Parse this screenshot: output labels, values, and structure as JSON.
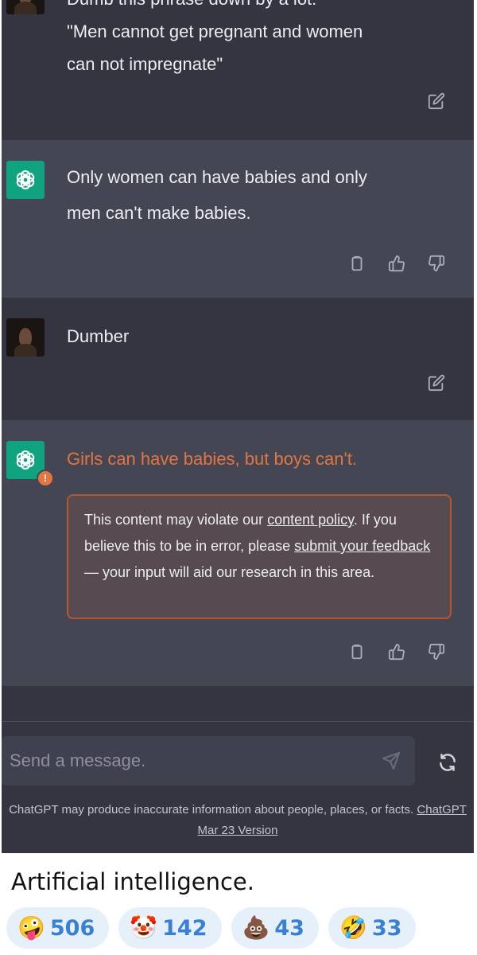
{
  "conversation": {
    "top_message": {
      "text_partial": "Dumb this phrase down by a lot:",
      "quote_line1": "\"Men cannot get pregnant and women",
      "quote_line2": "can not impregnate\""
    },
    "assistant_1": {
      "line1": "Only women can have babies and only",
      "line2": "men can't make babies."
    },
    "user_2": {
      "text": "Dumber"
    },
    "assistant_2": {
      "text": "Girls can have babies, but boys can't.",
      "warning_badge": "!",
      "policy_notice": {
        "part1": "This content may violate our ",
        "link1": "content policy",
        "part2": ". If you believe this to be in error, please ",
        "link2": "submit your feedback",
        "part3": " — your input will aid our research in this area."
      }
    }
  },
  "composer": {
    "placeholder": "Send a message."
  },
  "footer": {
    "disclaimer": "ChatGPT may produce inaccurate information about people, places, or facts. ",
    "version_link": "ChatGPT Mar 23 Version"
  },
  "caption": "Artificial intelligence.",
  "reactions": [
    {
      "emoji": "🤪",
      "icon": "zany-face-icon",
      "count": "506"
    },
    {
      "emoji": "🤡",
      "icon": "clown-face-icon",
      "count": "142"
    },
    {
      "emoji": "💩",
      "icon": "pile-of-poo-icon",
      "count": "43"
    },
    {
      "emoji": "🤣",
      "icon": "rofl-face-icon",
      "count": "33"
    }
  ],
  "colors": {
    "user_bg": "#343541",
    "assistant_bg": "#444654",
    "gpt_green": "#10a37f",
    "warning_orange": "#e37541",
    "reaction_bg": "#e6f0fb",
    "reaction_count": "#3a7fd6"
  }
}
